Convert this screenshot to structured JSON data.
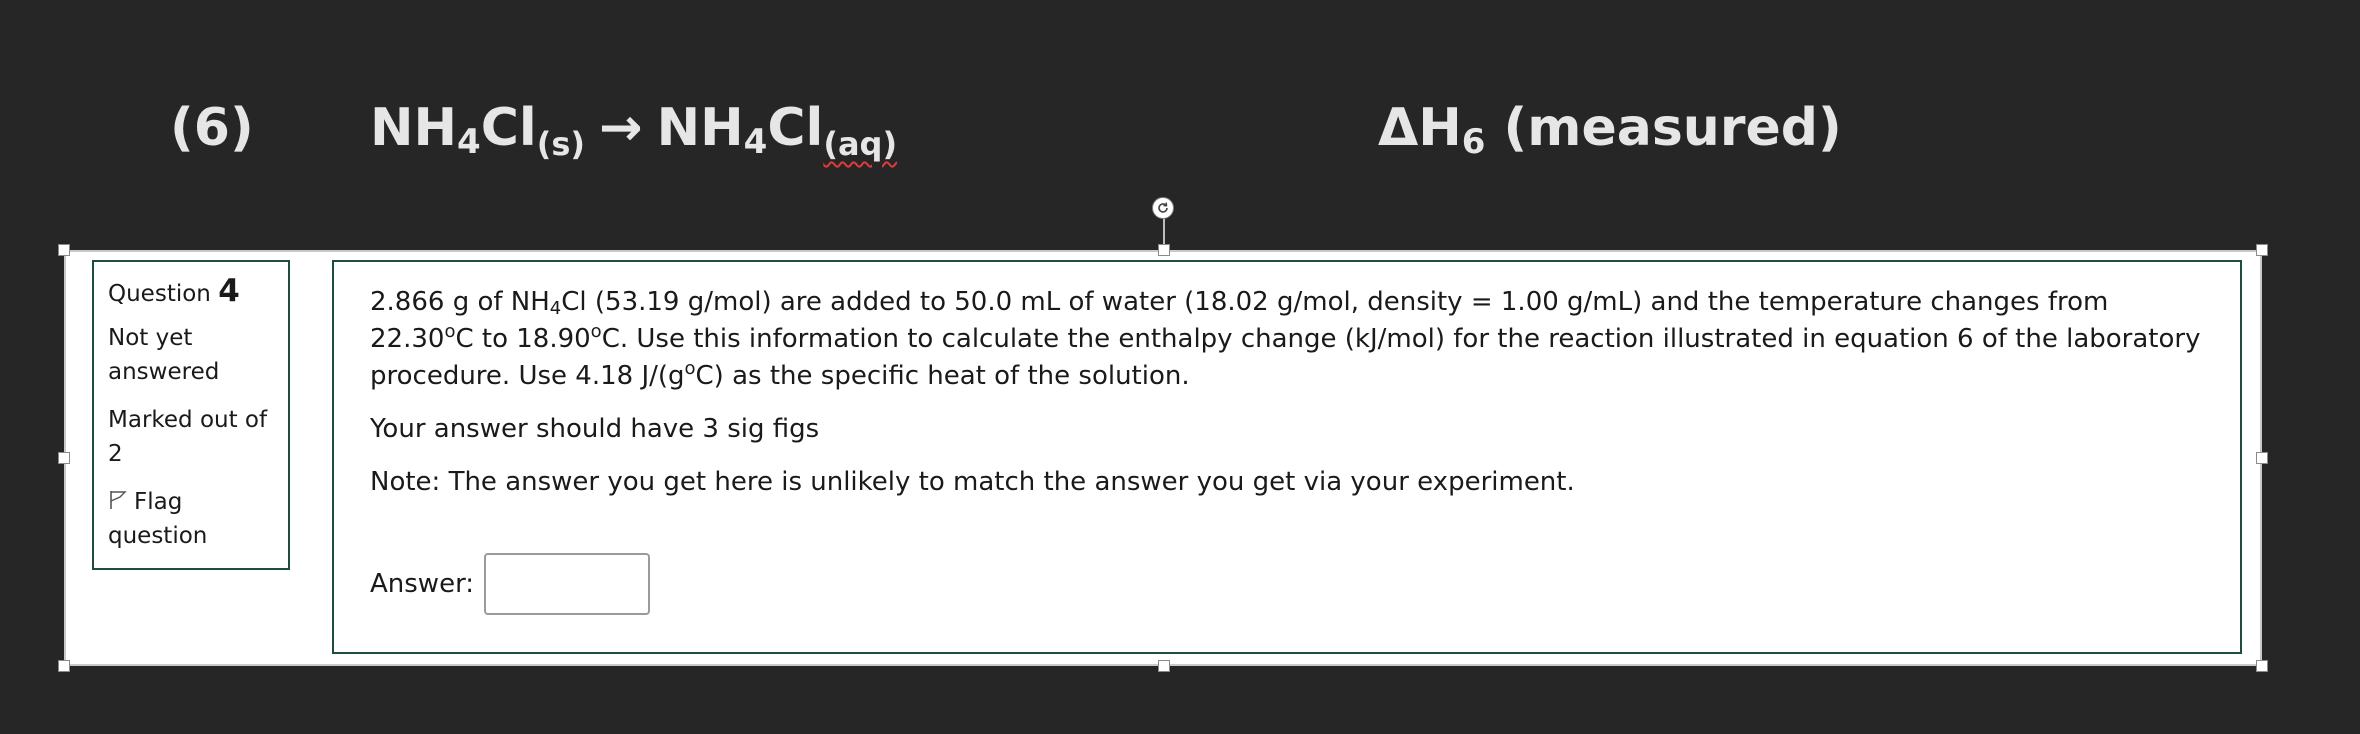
{
  "equation": {
    "number": "(6)",
    "reactant": "NH",
    "reactant_sub": "4",
    "reactant_tail": "Cl",
    "reactant_phase": "(s)",
    "arrow": "→",
    "product": "NH",
    "product_sub": "4",
    "product_tail": "Cl",
    "product_phase": "(aq)",
    "enthalpy_symbol": "ΔH",
    "enthalpy_sub": "6",
    "enthalpy_note": " (measured)"
  },
  "question": {
    "label": "Question ",
    "number": "4",
    "state": "Not yet answered",
    "marks": "Marked out of 2",
    "flag_label": "Flag question"
  },
  "content": {
    "p1_a": "2.866 g of NH",
    "p1_sub": "4",
    "p1_b": "Cl (53.19 g/mol) are added to 50.0 mL of water (18.02 g/mol, density = 1.00 g/mL) and the temperature changes from 22.30",
    "p1_sup1": "o",
    "p1_c": "C to 18.90",
    "p1_sup2": "o",
    "p1_d": "C.  Use this information to calculate the enthalpy change (kJ/mol) for the reaction illustrated in equation 6 of the laboratory procedure.  Use 4.18 J/(g",
    "p1_sup3": "o",
    "p1_e": "C) as the specific heat of the solution.",
    "sig_figs": "Your answer should have 3 sig figs",
    "note": "Note:  The answer you get here is unlikely to match the answer you get via your experiment.",
    "answer_label": "Answer:",
    "answer_value": ""
  },
  "colors": {
    "slide_background": "#262626",
    "quiz_border": "#1e4d3a",
    "spellcheck": "#e03a3a"
  }
}
